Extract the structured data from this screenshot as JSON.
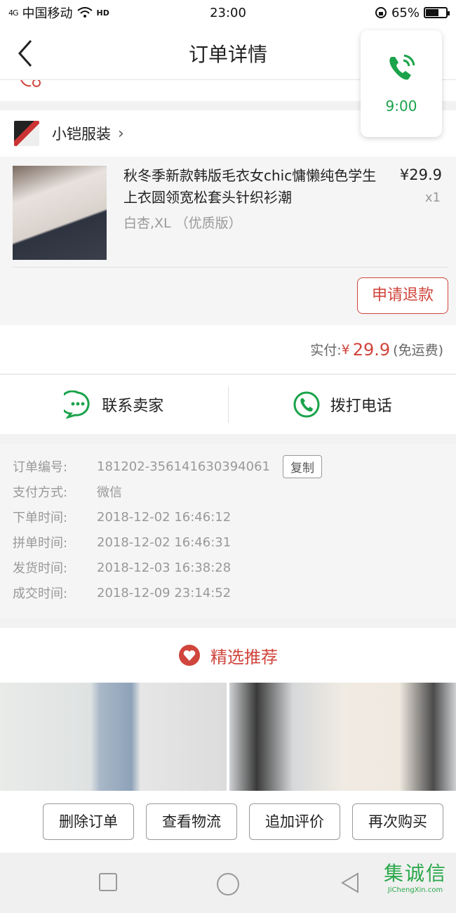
{
  "status_bar": {
    "signal": "4G",
    "carrier": "中国移动",
    "hd": "HD",
    "time": "23:00",
    "battery": "65%",
    "battery_level": 0.65
  },
  "nav": {
    "title": "订单详情"
  },
  "call_float": {
    "timer": "9:00"
  },
  "store": {
    "name": "小铠服装"
  },
  "product": {
    "title": "秋冬季新款韩版毛衣女chic慵懒纯色学生上衣圆领宽松套头针织衫潮",
    "spec": "白杏,XL （优质版）",
    "price": "¥29.9",
    "qty": "x1",
    "refund_label": "申请退款"
  },
  "payment": {
    "label": "实付:",
    "currency": "¥",
    "amount": "29.9",
    "note": "(免运费)"
  },
  "contact": {
    "seller_label": "联系卖家",
    "call_label": "拨打电话"
  },
  "order_info": {
    "rows": [
      {
        "label": "订单编号:",
        "value": "181202-356141630394061"
      },
      {
        "label": "支付方式:",
        "value": "微信"
      },
      {
        "label": "下单时间:",
        "value": "2018-12-02 16:46:12"
      },
      {
        "label": "拼单时间:",
        "value": "2018-12-02 16:46:31"
      },
      {
        "label": "发货时间:",
        "value": "2018-12-03 16:38:28"
      },
      {
        "label": "成交时间:",
        "value": "2018-12-09 23:14:52"
      }
    ],
    "copy_label": "复制"
  },
  "recommend": {
    "title": "精选推荐"
  },
  "actions": {
    "delete": "删除订单",
    "logistics": "查看物流",
    "review": "追加评价",
    "rebuy": "再次购买"
  },
  "watermark": {
    "logo": "集诚信",
    "url": "JiChengXin.com"
  },
  "colors": {
    "accent": "#d0453c",
    "green": "#1aa34a"
  }
}
